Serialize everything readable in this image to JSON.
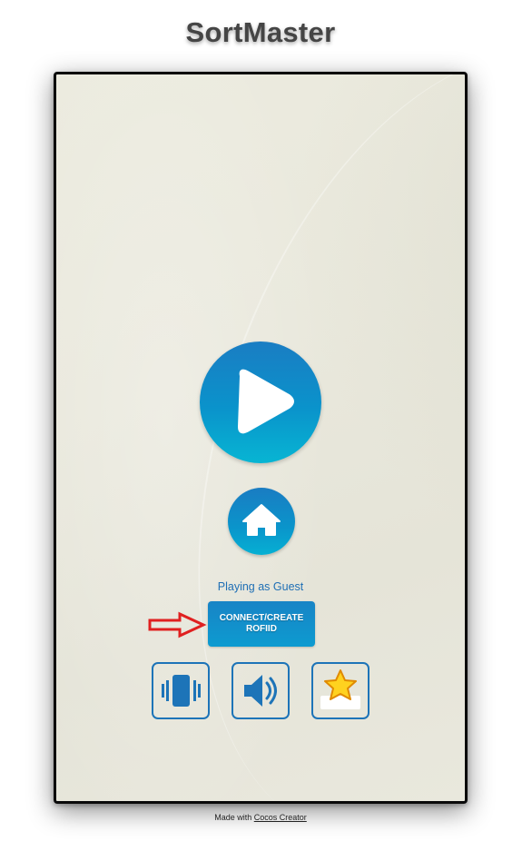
{
  "site": {
    "title": "SortMaster"
  },
  "menu": {
    "status_text": "Playing as Guest",
    "connect_label": "CONNECT/CREATE ROFIID"
  },
  "footer": {
    "prefix": "Made with",
    "link": "Cocos Creator"
  },
  "icons": {
    "play": "play-icon",
    "home": "home-icon",
    "vibrate": "vibrate-icon",
    "sound": "speaker-icon",
    "rate": "star-icon",
    "annotation": "red-arrow-icon"
  },
  "colors": {
    "accent": "#0a93cb",
    "annotation": "#e02020",
    "background": "#eae9de"
  }
}
